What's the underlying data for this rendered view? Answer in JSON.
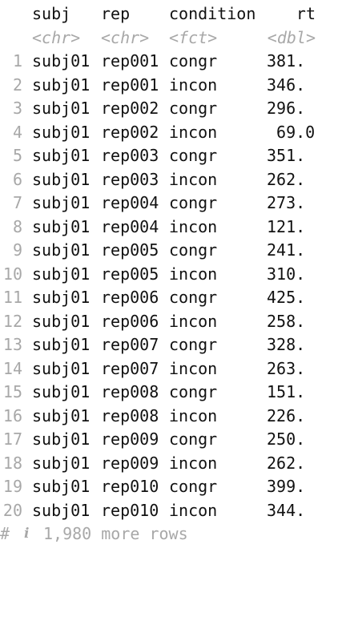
{
  "table": {
    "headers": {
      "subj": "subj",
      "rep": "rep",
      "condition": "condition",
      "rt": "rt"
    },
    "types": {
      "subj": "<chr>",
      "rep": "<chr>",
      "condition": "<fct>",
      "rt": "<dbl>"
    },
    "rows": [
      {
        "idx": "1",
        "subj": "subj01",
        "rep": "rep001",
        "condition": "congr",
        "rt": "381."
      },
      {
        "idx": "2",
        "subj": "subj01",
        "rep": "rep001",
        "condition": "incon",
        "rt": "346."
      },
      {
        "idx": "3",
        "subj": "subj01",
        "rep": "rep002",
        "condition": "congr",
        "rt": "296."
      },
      {
        "idx": "4",
        "subj": "subj01",
        "rep": "rep002",
        "condition": "incon",
        "rt": " 69.0"
      },
      {
        "idx": "5",
        "subj": "subj01",
        "rep": "rep003",
        "condition": "congr",
        "rt": "351."
      },
      {
        "idx": "6",
        "subj": "subj01",
        "rep": "rep003",
        "condition": "incon",
        "rt": "262."
      },
      {
        "idx": "7",
        "subj": "subj01",
        "rep": "rep004",
        "condition": "congr",
        "rt": "273."
      },
      {
        "idx": "8",
        "subj": "subj01",
        "rep": "rep004",
        "condition": "incon",
        "rt": "121."
      },
      {
        "idx": "9",
        "subj": "subj01",
        "rep": "rep005",
        "condition": "congr",
        "rt": "241."
      },
      {
        "idx": "10",
        "subj": "subj01",
        "rep": "rep005",
        "condition": "incon",
        "rt": "310."
      },
      {
        "idx": "11",
        "subj": "subj01",
        "rep": "rep006",
        "condition": "congr",
        "rt": "425."
      },
      {
        "idx": "12",
        "subj": "subj01",
        "rep": "rep006",
        "condition": "incon",
        "rt": "258."
      },
      {
        "idx": "13",
        "subj": "subj01",
        "rep": "rep007",
        "condition": "congr",
        "rt": "328."
      },
      {
        "idx": "14",
        "subj": "subj01",
        "rep": "rep007",
        "condition": "incon",
        "rt": "263."
      },
      {
        "idx": "15",
        "subj": "subj01",
        "rep": "rep008",
        "condition": "congr",
        "rt": "151."
      },
      {
        "idx": "16",
        "subj": "subj01",
        "rep": "rep008",
        "condition": "incon",
        "rt": "226."
      },
      {
        "idx": "17",
        "subj": "subj01",
        "rep": "rep009",
        "condition": "congr",
        "rt": "250."
      },
      {
        "idx": "18",
        "subj": "subj01",
        "rep": "rep009",
        "condition": "incon",
        "rt": "262."
      },
      {
        "idx": "19",
        "subj": "subj01",
        "rep": "rep010",
        "condition": "congr",
        "rt": "399."
      },
      {
        "idx": "20",
        "subj": "subj01",
        "rep": "rep010",
        "condition": "incon",
        "rt": "344."
      }
    ],
    "footer": {
      "prefix": "#",
      "icon": "i",
      "text": "1,980 more rows"
    }
  },
  "colors": {
    "text": "#111111",
    "muted": "#a8a8a8",
    "background": "#ffffff"
  }
}
